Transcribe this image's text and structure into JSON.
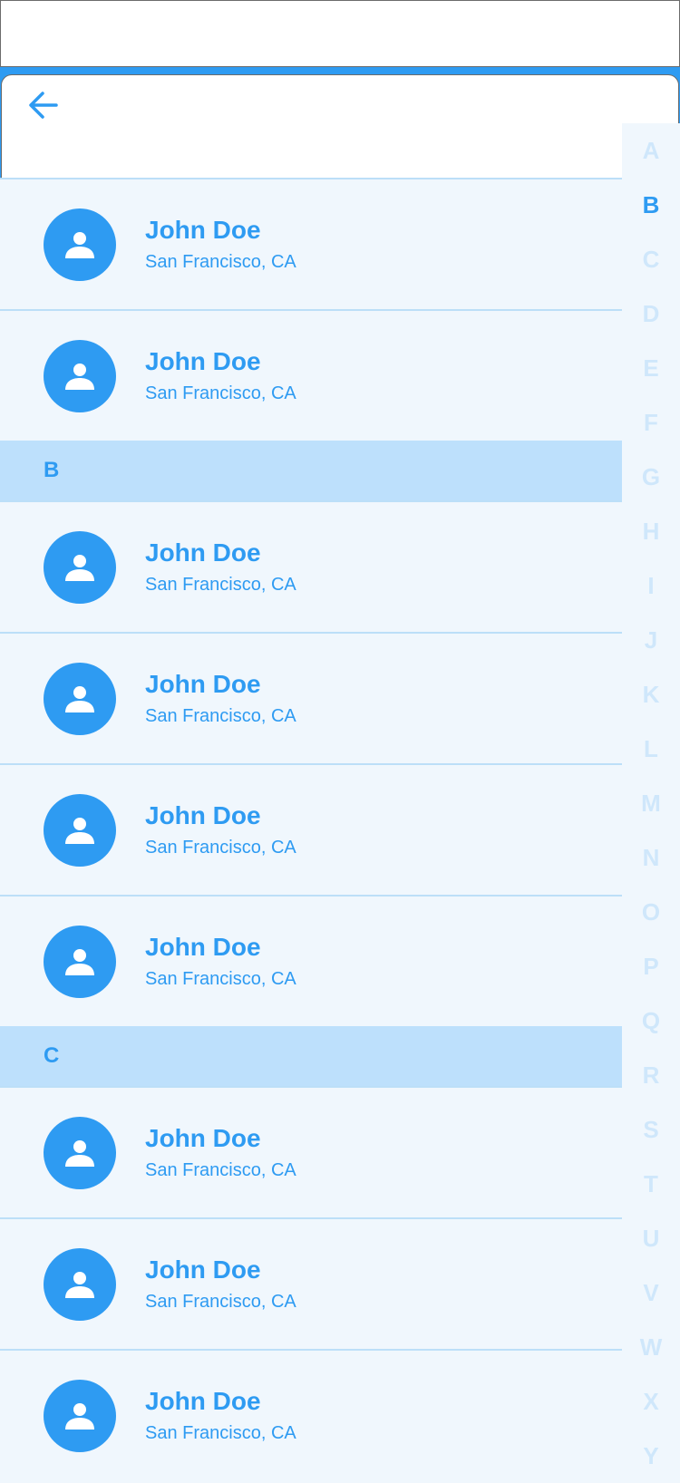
{
  "colors": {
    "accent": "#2e9bf2",
    "section_bg": "#bde0fc",
    "row_bg": "#f0f7fd",
    "index_inactive": "#cfe7fb"
  },
  "header": {
    "back_icon": "arrow-left-icon"
  },
  "list": [
    {
      "type": "contact",
      "name": "John Doe",
      "city": "San Francisco, CA"
    },
    {
      "type": "contact",
      "name": "John Doe",
      "city": "San Francisco, CA"
    },
    {
      "type": "section",
      "label": "B"
    },
    {
      "type": "contact",
      "name": "John Doe",
      "city": "San Francisco, CA"
    },
    {
      "type": "contact",
      "name": "John Doe",
      "city": "San Francisco, CA"
    },
    {
      "type": "contact",
      "name": "John Doe",
      "city": "San Francisco, CA"
    },
    {
      "type": "contact",
      "name": "John Doe",
      "city": "San Francisco, CA"
    },
    {
      "type": "section",
      "label": "C"
    },
    {
      "type": "contact",
      "name": "John Doe",
      "city": "San Francisco, CA"
    },
    {
      "type": "contact",
      "name": "John Doe",
      "city": "San Francisco, CA"
    },
    {
      "type": "contact",
      "name": "John Doe",
      "city": "San Francisco, CA"
    }
  ],
  "alphabet_index": {
    "letters": [
      "A",
      "B",
      "C",
      "D",
      "E",
      "F",
      "G",
      "H",
      "I",
      "J",
      "K",
      "L",
      "M",
      "N",
      "O",
      "P",
      "Q",
      "R",
      "S",
      "T",
      "U",
      "V",
      "W",
      "X",
      "Y"
    ],
    "active": "B"
  }
}
